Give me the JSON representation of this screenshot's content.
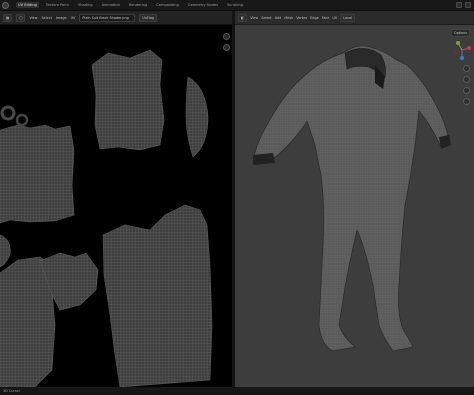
{
  "workspace_tabs": [
    "UV Editing",
    "Texture Paint",
    "Shading",
    "Animation",
    "Rendering",
    "Compositing",
    "Geometry Nodes",
    "Scripting"
  ],
  "uv_editor": {
    "view_label": "View",
    "select_label": "Select",
    "image_label": "Image",
    "uv_label": "UV",
    "image_name": "Plain Suit Black Shader.png",
    "unflag_label": "UnFlag"
  },
  "viewport": {
    "menus": [
      "View",
      "Select",
      "Add",
      "Mesh",
      "Vertex",
      "Edge",
      "Face",
      "UV"
    ],
    "transform_label": "Local",
    "options_label": "Options"
  },
  "status": {
    "text": "3D Cursor"
  },
  "colors": {
    "uv_background": "#000000",
    "viewport_background": "#3d3d3d",
    "mesh_fill": "#5c5c5c",
    "uv_island_fill": "#4a4a4a",
    "gizmo_x": "#c83a4a",
    "gizmo_y": "#7aa33a",
    "gizmo_z": "#3a7fd0"
  },
  "icons": [
    "blender-logo-icon",
    "editor-type-icon",
    "zoom-icon",
    "hand-icon",
    "axis-gizmo-icon",
    "camera-icon",
    "grid-icon"
  ]
}
